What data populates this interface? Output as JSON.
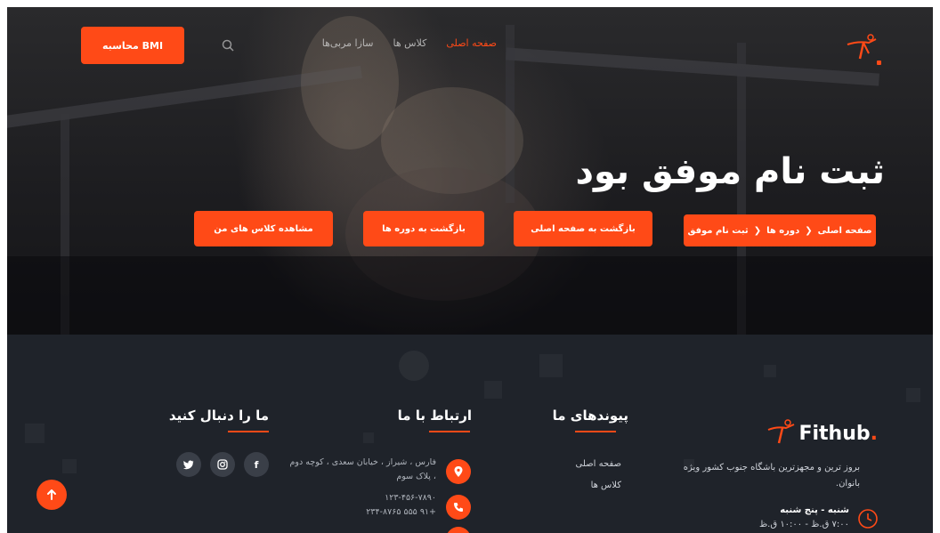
{
  "nav": {
    "bmi_button": "محاسبه BMI",
    "links": [
      "صفحه اصلی",
      "کلاس ها",
      "سازا مربی‌ها"
    ],
    "search_icon": "search-icon",
    "logo_icon": "fithub-logo-icon"
  },
  "hero": {
    "title": "ثبت نام موفق بود",
    "breadcrumb": [
      "صفحه اصلی",
      "دوره ها",
      "ثبت نام موفق"
    ],
    "buttons": {
      "home": "بازگشت به صفحه اصلی",
      "courses": "بازگشت به دوره ها",
      "my_classes": "مشاهده کلاس های من"
    }
  },
  "footer": {
    "brand": "Fithub",
    "brand_dot": ".",
    "description": "بروز ترین و مجهزترین باشگاه جنوب کشور ویژه بانوان.",
    "hours_title": "شنبه - پنج شنبه",
    "hours_time": "۷:۰۰ ق.ظ - ۱۰:۰۰ ق.ظ",
    "links_title": "پیوندهای ما",
    "links": [
      "صفحه اصلی",
      "کلاس ها"
    ],
    "contact_title": "ارتباط با ما",
    "address": "فارس ، شیراز ، خیابان سعدی ، کوچه دوم ، پلاک سوم",
    "phone_1": "۱۲۳-۴۵۶-۷۸۹۰",
    "phone_2": "+۹۱ ۵۵۵ ۲۳۴-۸۷۶۵",
    "follow_title": "ما را دنبال کنید",
    "social_icons": [
      "facebook-icon",
      "instagram-icon",
      "twitter-icon"
    ]
  },
  "colors": {
    "accent": "#ff4a17",
    "footer_bg": "#1f232a"
  }
}
